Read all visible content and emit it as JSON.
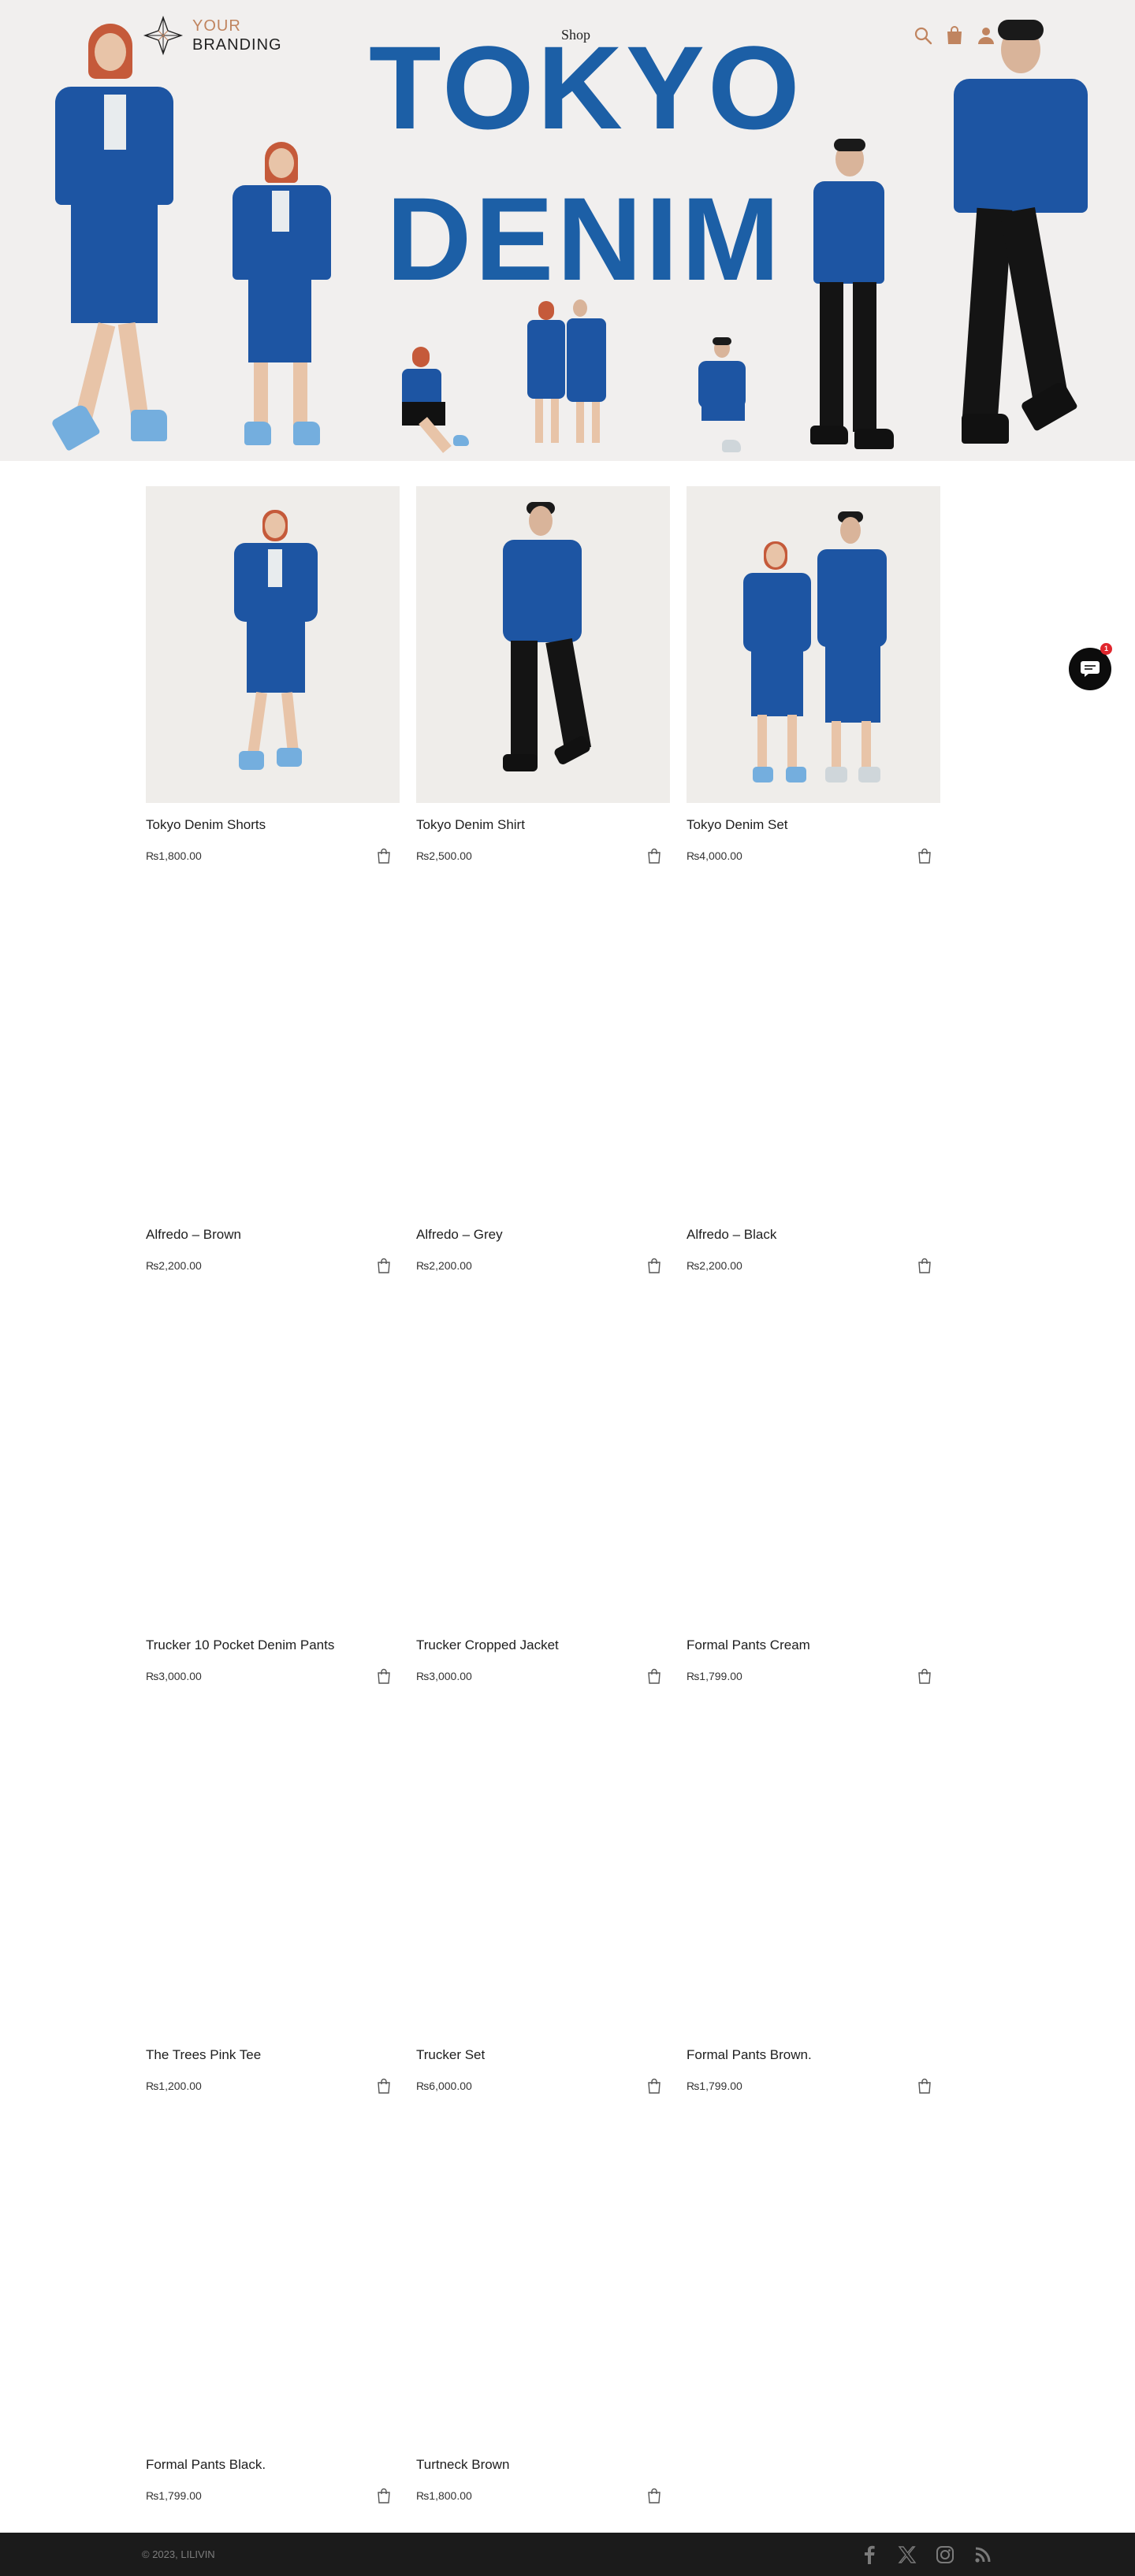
{
  "brand": {
    "line1": "YOUR",
    "line2": "BRANDING",
    "accent": "#c0845f"
  },
  "nav": {
    "shop": "Shop"
  },
  "header_icons": [
    "search-icon",
    "shopping-bag-icon",
    "user-icon"
  ],
  "hero": {
    "title_line1": "TOKYO",
    "title_line2": "DENIM",
    "title_color": "#1c5fa6"
  },
  "products": [
    {
      "name": "Tokyo Denim Shorts",
      "price": "₨1,800.00",
      "image": "model-woman"
    },
    {
      "name": "Tokyo Denim Shirt",
      "price": "₨2,500.00",
      "image": "model-man"
    },
    {
      "name": "Tokyo Denim Set",
      "price": "₨4,000.00",
      "image": "model-pair"
    },
    {
      "name": "Alfredo – Brown",
      "price": "₨2,200.00"
    },
    {
      "name": "Alfredo – Grey",
      "price": "₨2,200.00"
    },
    {
      "name": "Alfredo – Black",
      "price": "₨2,200.00"
    },
    {
      "name": "Trucker 10 Pocket Denim Pants",
      "price": "₨3,000.00"
    },
    {
      "name": "Trucker Cropped Jacket",
      "price": "₨3,000.00"
    },
    {
      "name": "Formal Pants Cream",
      "price": "₨1,799.00"
    },
    {
      "name": "The Trees Pink Tee",
      "price": "₨1,200.00"
    },
    {
      "name": "Trucker Set",
      "price": "₨6,000.00"
    },
    {
      "name": "Formal Pants Brown.",
      "price": "₨1,799.00"
    },
    {
      "name": "Formal Pants Black.",
      "price": "₨1,799.00"
    },
    {
      "name": "Turtneck Brown",
      "price": "₨1,800.00"
    }
  ],
  "chat": {
    "badge": "1",
    "icon": "chat-icon"
  },
  "footer": {
    "copyright": "© 2023, LILIVIN",
    "social_icons": [
      "facebook-icon",
      "x-icon",
      "instagram-icon",
      "rss-icon"
    ]
  }
}
